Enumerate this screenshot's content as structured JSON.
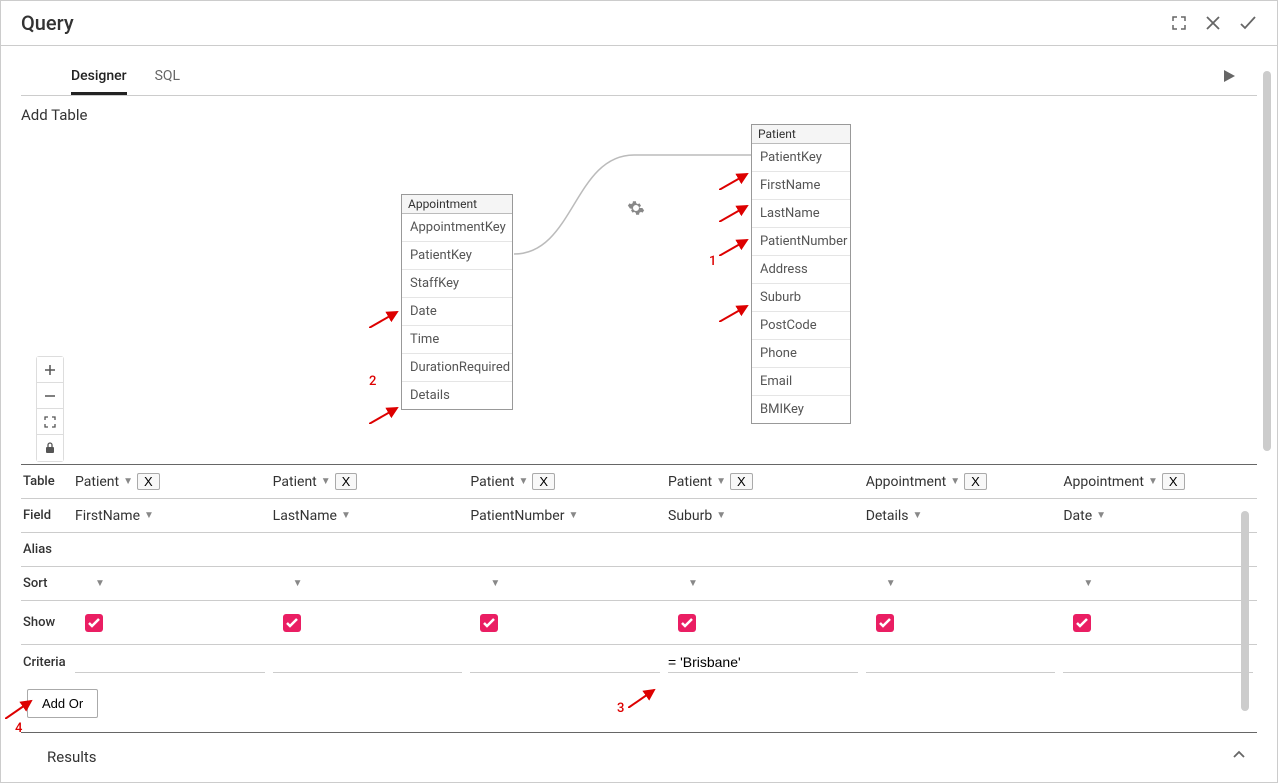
{
  "header": {
    "title": "Query"
  },
  "tabs": {
    "designer": "Designer",
    "sql": "SQL",
    "active": "designer"
  },
  "addTableLabel": "Add Table",
  "tables": {
    "appointment": {
      "name": "Appointment",
      "fields": [
        "AppointmentKey",
        "PatientKey",
        "StaffKey",
        "Date",
        "Time",
        "DurationRequired",
        "Details"
      ]
    },
    "patient": {
      "name": "Patient",
      "fields": [
        "PatientKey",
        "FirstName",
        "LastName",
        "PatientNumber",
        "Address",
        "Suburb",
        "PostCode",
        "Phone",
        "Email",
        "BMIKey"
      ]
    }
  },
  "annotations": {
    "one": "1",
    "two": "2",
    "three": "3",
    "four": "4"
  },
  "grid": {
    "labels": {
      "table": "Table",
      "field": "Field",
      "alias": "Alias",
      "sort": "Sort",
      "show": "Show",
      "criteria": "Criteria"
    },
    "xLabel": "X",
    "columns": [
      {
        "table": "Patient",
        "field": "FirstName",
        "show": true,
        "criteria": ""
      },
      {
        "table": "Patient",
        "field": "LastName",
        "show": true,
        "criteria": ""
      },
      {
        "table": "Patient",
        "field": "PatientNumber",
        "show": true,
        "criteria": ""
      },
      {
        "table": "Patient",
        "field": "Suburb",
        "show": true,
        "criteria": "= 'Brisbane'"
      },
      {
        "table": "Appointment",
        "field": "Details",
        "show": true,
        "criteria": ""
      },
      {
        "table": "Appointment",
        "field": "Date",
        "show": true,
        "criteria": ""
      }
    ]
  },
  "addOrLabel": "Add Or",
  "resultsLabel": "Results"
}
